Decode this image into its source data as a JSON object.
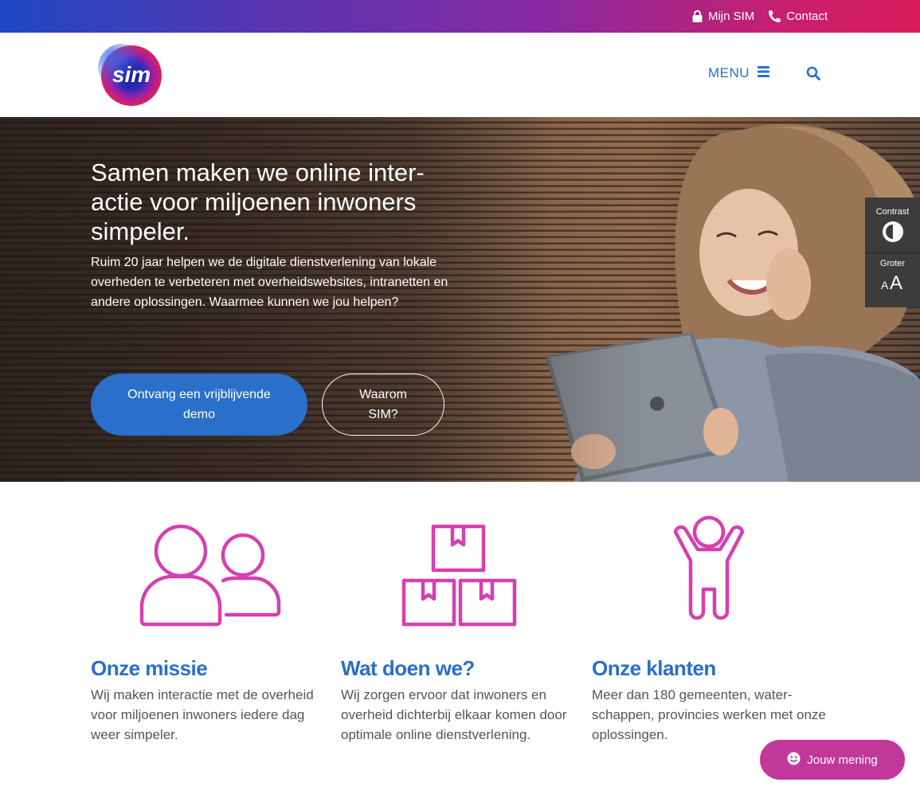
{
  "topbar": {
    "mijn_sim": "Mijn SIM",
    "contact": "Contact"
  },
  "header": {
    "logo_text": "sim",
    "menu_label": "MENU"
  },
  "hero": {
    "title": "Samen maken we online inter-actie voor miljoenen inwoners simpeler.",
    "text": "Ruim 20 jaar helpen we de digitale dienstverlening van lokale overheden te verbeteren met overheidswebsites, intranetten en andere oplossingen. Waarmee kunnen we jou helpen?",
    "primary_button": "Ontvang een vrijblijvende demo",
    "secondary_button": "Waarom SIM?"
  },
  "accessibility": {
    "contrast_label": "Contrast",
    "larger_label": "Groter"
  },
  "features": [
    {
      "icon": "people-icon",
      "title": "Onze missie",
      "text": "Wij maken interactie met de overheid voor miljoenen inwoners iedere dag weer simpeler."
    },
    {
      "icon": "boxes-icon",
      "title": "Wat doen we?",
      "text": "Wij zorgen ervoor dat inwoners en overheid dichterbij elkaar komen door optimale online dienstverlening."
    },
    {
      "icon": "person-cheering-icon",
      "title": "Onze klanten",
      "text": "Meer dan 180 gemeenten, water-schappen, provincies werken met onze oplossingen."
    }
  ],
  "feedback": {
    "label": "Jouw mening"
  },
  "colors": {
    "primary_blue": "#2a6fc9",
    "accent_pink": "#c2389a",
    "icon_pink": "#d63fb0"
  }
}
